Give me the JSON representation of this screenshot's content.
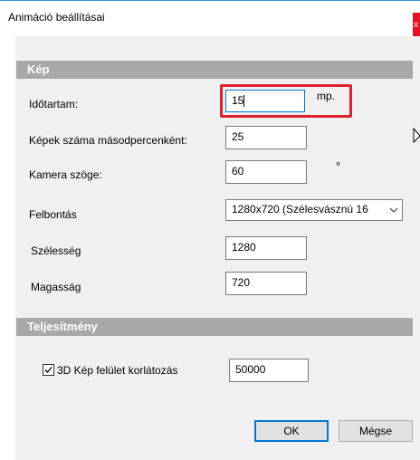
{
  "window": {
    "title": "Animáció beállításai",
    "close_label": "x"
  },
  "sections": {
    "image_header": "Kép",
    "performance_header": "Teljesítmény"
  },
  "fields": {
    "duration": {
      "label": "Időtartam:",
      "value": "15",
      "unit": "mp."
    },
    "fps": {
      "label": "Képek száma másodpercenként:",
      "value": "25"
    },
    "camera_angle": {
      "label": "Kamera szöge:",
      "value": "60",
      "unit": "°"
    },
    "resolution": {
      "label": "Felbontás",
      "selected": "1280x720  (Szélesvásznú 16"
    },
    "width": {
      "label": "Szélesség",
      "value": "1280"
    },
    "height": {
      "label": "Magasság",
      "value": "720"
    },
    "surface_limit": {
      "label": "3D Kép felület korlátozás",
      "checked": true,
      "value": "50000"
    }
  },
  "buttons": {
    "ok": "OK",
    "cancel": "Mégse"
  },
  "colors": {
    "highlight": "#e0202d",
    "focus": "#0078d7",
    "section_bg": "#a8a8a8",
    "close_bg": "#e81123"
  }
}
